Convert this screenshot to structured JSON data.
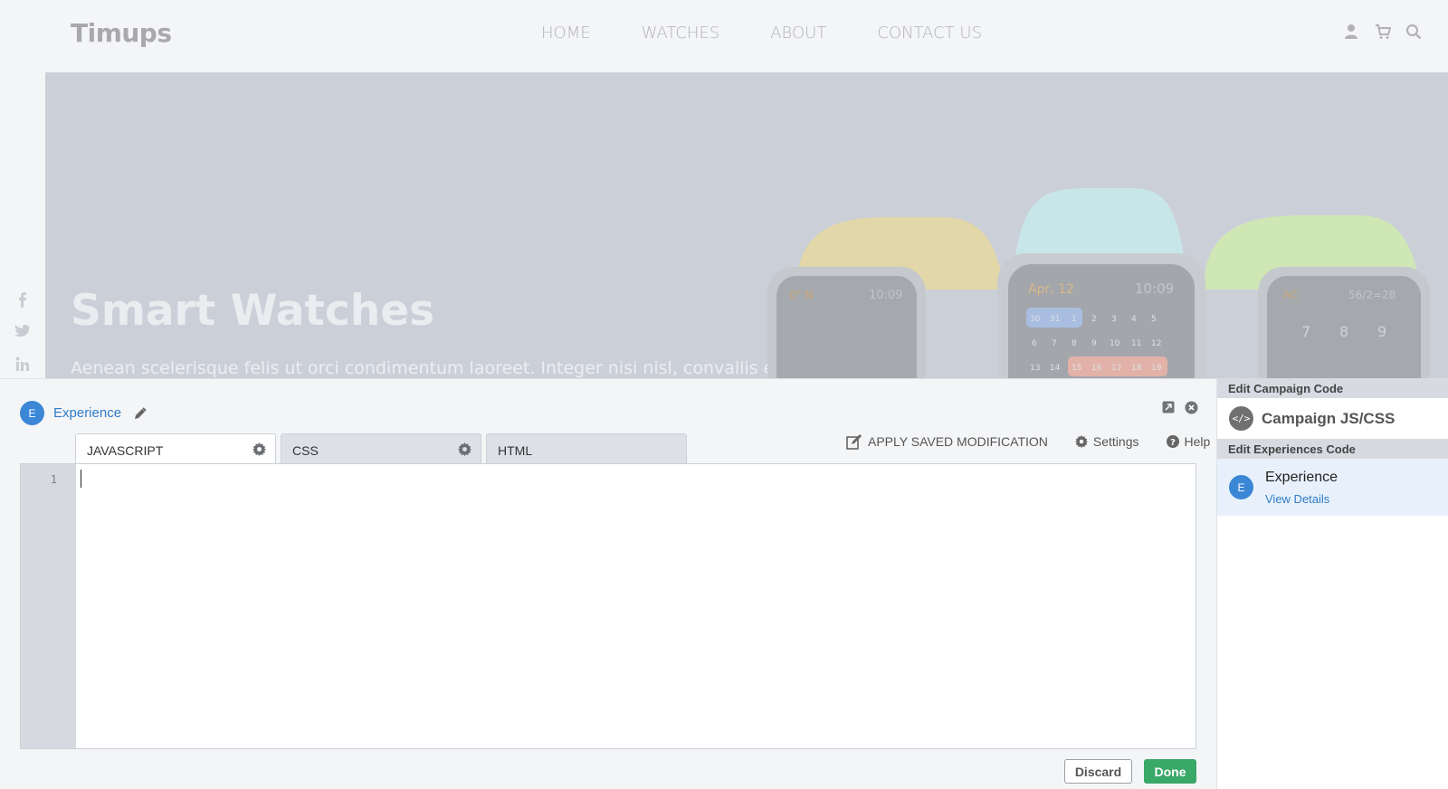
{
  "site": {
    "logo": "Timups",
    "menu": [
      "HOME",
      "WATCHES",
      "ABOUT",
      "CONTACT US"
    ],
    "hero_title": "Smart Watches",
    "hero_text": "Aenean scelerisque felis ut orci condimentum laoreet. Integer nisi nisl, convallis et",
    "watch_left": {
      "label1": "0° N",
      "time": "10:09"
    },
    "watch_center": {
      "date": "Apr, 12",
      "time": "10:09",
      "row1": [
        "30",
        "31",
        "1",
        "2",
        "3",
        "4",
        "5"
      ],
      "row2": [
        "6",
        "7",
        "8",
        "9",
        "10",
        "11",
        "12"
      ],
      "row3": [
        "13",
        "14",
        "15",
        "16",
        "17",
        "18",
        "19"
      ]
    },
    "watch_right": {
      "label1": "AC",
      "expr": "56/2=28",
      "keys": [
        "7",
        "8",
        "9"
      ]
    }
  },
  "editor": {
    "avatar_letter": "E",
    "experience_name": "Experience",
    "tabs": [
      {
        "label": "JAVASCRIPT",
        "active": true,
        "has_gear": true
      },
      {
        "label": "CSS",
        "active": false,
        "has_gear": true
      },
      {
        "label": "HTML",
        "active": false,
        "has_gear": false
      }
    ],
    "actions": {
      "apply": "APPLY SAVED MODIFICATION",
      "settings": "Settings",
      "help": "Help"
    },
    "line_number": "1",
    "discard": "Discard",
    "done": "Done"
  },
  "sidebar": {
    "campaign_header": "Edit Campaign Code",
    "campaign_icon": "</>",
    "campaign_label": "Campaign JS/CSS",
    "experiences_header": "Edit Experiences Code",
    "experience_avatar": "E",
    "experience_name": "Experience",
    "view_details": "View Details"
  },
  "colors": {
    "accent": "#2f7bc7",
    "done": "#3aa867",
    "avatar": "#3b87d6"
  }
}
